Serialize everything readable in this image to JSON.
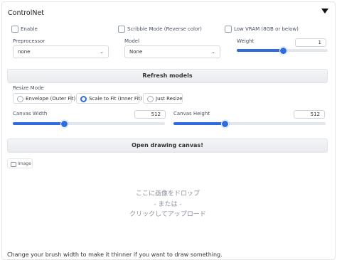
{
  "header": {
    "title": "ControlNet"
  },
  "options": {
    "enable": "Enable",
    "scribble": "Scribble Mode (Reverse color)",
    "low_vram": "Low VRAM (8GB or below)"
  },
  "preprocessor": {
    "label": "Preprocessor",
    "value": "none"
  },
  "model": {
    "label": "Model",
    "value": "None"
  },
  "weight": {
    "label": "Weight",
    "value": "1",
    "fraction": 0.5
  },
  "refresh_button": "Refresh models",
  "resize_mode": {
    "label": "Resize Mode",
    "options": [
      "Envelope (Outer Fit)",
      "Scale to Fit (Inner Fit)",
      "Just Resize"
    ],
    "selected": "Scale to Fit (Inner Fit)"
  },
  "canvas_width": {
    "label": "Canvas Width",
    "value": "512",
    "fraction": 0.33
  },
  "canvas_height": {
    "label": "Canvas Height",
    "value": "512",
    "fraction": 0.33
  },
  "open_canvas_button": "Open drawing canvas!",
  "image_tab": "Image",
  "dropzone": {
    "line1": "ここに画像をドロップ",
    "line2": "- または -",
    "line3": "クリックしてアップロード"
  },
  "hint": "Change your brush width to make it thinner if you want to draw something."
}
